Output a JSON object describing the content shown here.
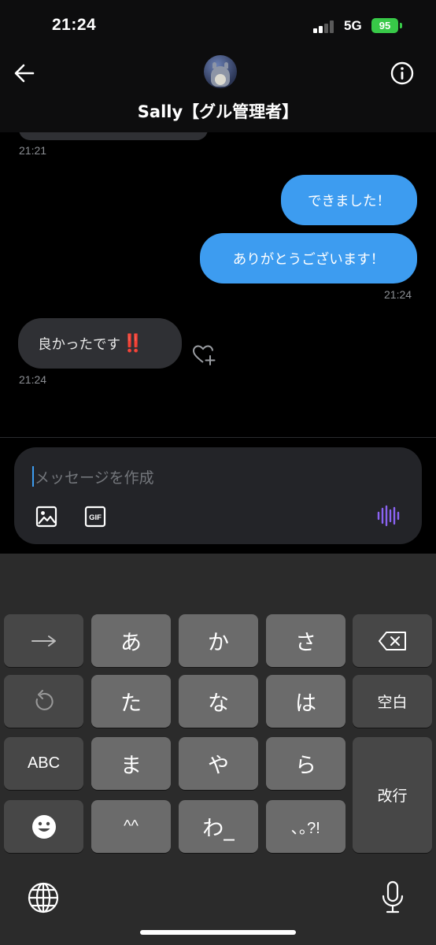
{
  "status_bar": {
    "time": "21:24",
    "network": "5G",
    "battery": "95"
  },
  "header": {
    "title": "Sally【グル管理者】",
    "back_icon": "back-arrow-icon",
    "info_icon": "info-icon"
  },
  "messages": [
    {
      "direction": "in",
      "time": "21:21",
      "partial": true
    },
    {
      "direction": "out",
      "text": "できました！"
    },
    {
      "direction": "out",
      "text": "ありがとうございます！",
      "time": "21:24"
    },
    {
      "direction": "in",
      "text": "良かったです",
      "emoji": "‼️",
      "time": "21:24"
    }
  ],
  "composer": {
    "placeholder": "メッセージを作成",
    "image_icon": "image-icon",
    "gif_label": "GIF",
    "voice_icon": "voice-waveform-icon"
  },
  "keyboard": {
    "rows": [
      [
        "→",
        "あ",
        "か",
        "さ",
        "⌫"
      ],
      [
        "↺",
        "た",
        "な",
        "は",
        "空白"
      ],
      [
        "ABC",
        "ま",
        "や",
        "ら",
        "改行"
      ],
      [
        "☻",
        "^^",
        "わ_",
        "､｡?!"
      ]
    ],
    "enter_label": "改行",
    "space_label": "空白",
    "abc_label": "ABC",
    "globe_icon": "globe-icon",
    "mic_icon": "microphone-icon"
  },
  "colors": {
    "outgoing_bubble": "#3d9cf0",
    "incoming_bubble": "#2f3034",
    "accent_voice": "#8a63f2"
  }
}
